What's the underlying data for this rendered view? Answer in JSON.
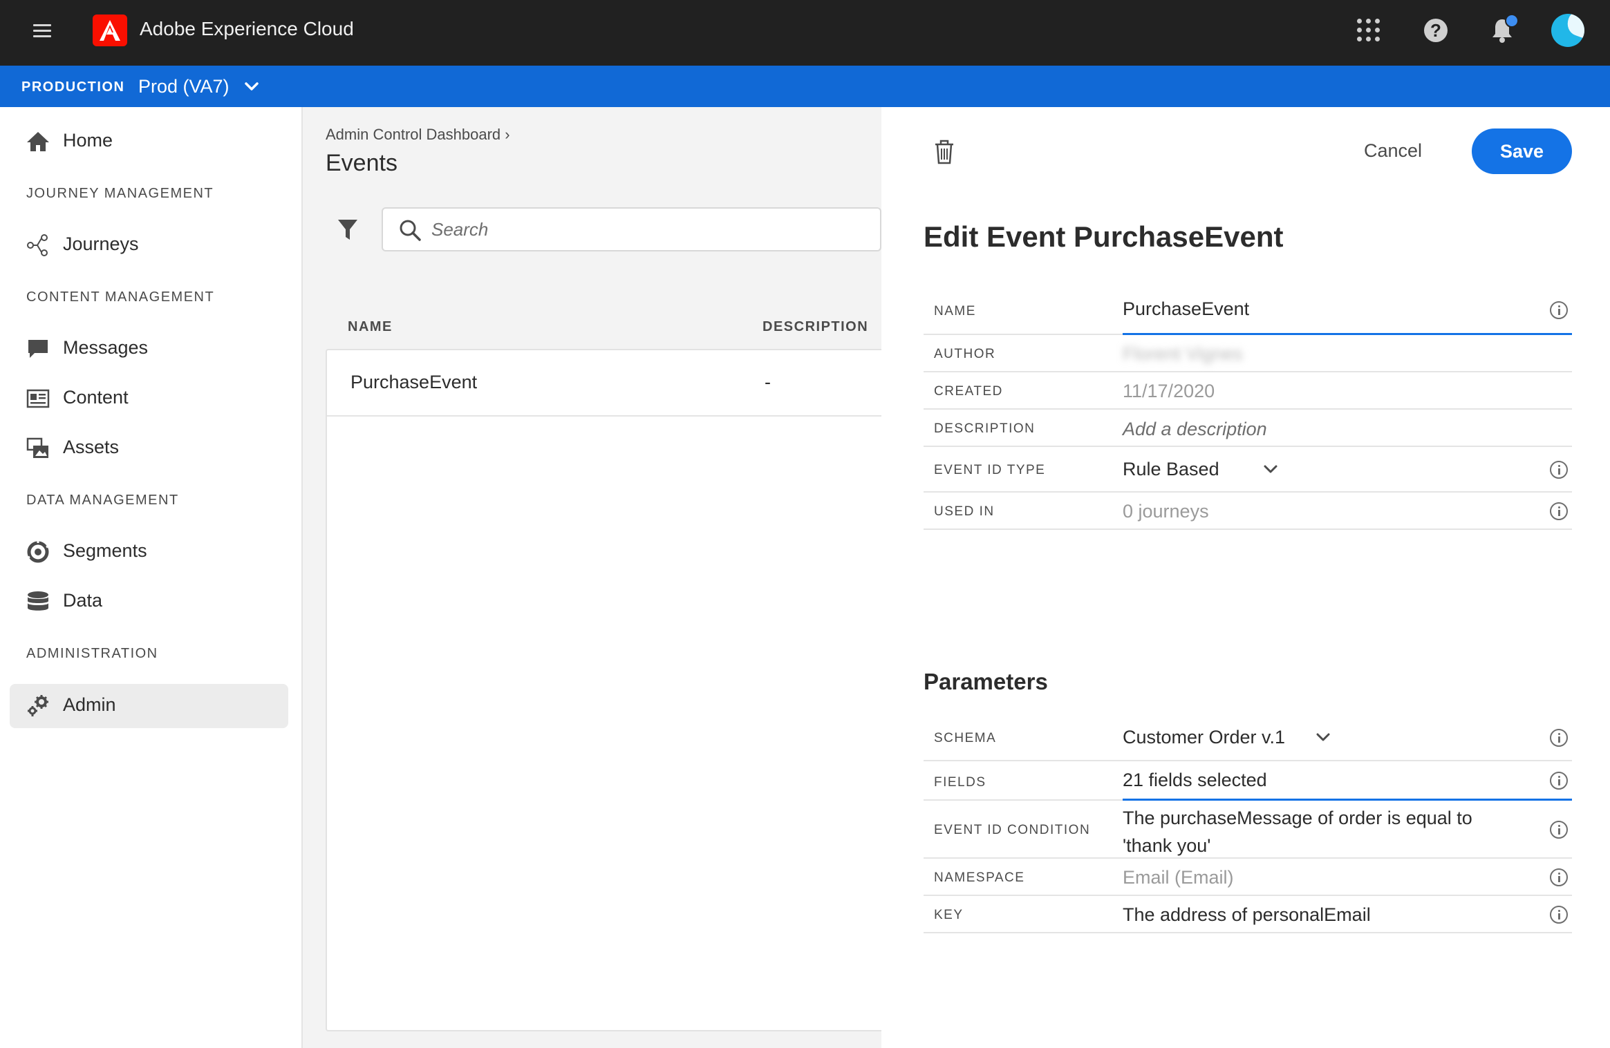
{
  "topbar": {
    "app_title": "Adobe Experience Cloud",
    "icons": [
      "menu-icon",
      "adobe-logo",
      "apps-grid-icon",
      "help-icon",
      "notifications-icon",
      "user-avatar"
    ],
    "notification_dot_color": "#3d8ef2"
  },
  "envbar": {
    "label": "PRODUCTION",
    "value": "Prod (VA7)",
    "background": "#1169d6"
  },
  "sidebar": {
    "home": "Home",
    "sections": {
      "journey": "JOURNEY MANAGEMENT",
      "content": "CONTENT MANAGEMENT",
      "data": "DATA MANAGEMENT",
      "admin": "ADMINISTRATION"
    },
    "items": {
      "journeys": "Journeys",
      "messages": "Messages",
      "content": "Content",
      "assets": "Assets",
      "segments": "Segments",
      "data": "Data",
      "admin": "Admin"
    },
    "active_item": "Admin"
  },
  "events_list": {
    "breadcrumb": "Admin Control Dashboard",
    "title": "Events",
    "search_placeholder": "Search",
    "columns": [
      "NAME",
      "DESCRIPTION"
    ],
    "rows": [
      {
        "name": "PurchaseEvent",
        "description": "-"
      }
    ]
  },
  "edit_panel": {
    "cancel_label": "Cancel",
    "save_label": "Save",
    "title": "Edit Event PurchaseEvent",
    "accent_color": "#1473e6",
    "fields": {
      "name": {
        "label": "NAME",
        "value": "PurchaseEvent"
      },
      "author": {
        "label": "AUTHOR",
        "value": "Florent Vignes"
      },
      "created": {
        "label": "CREATED",
        "value": "11/17/2020"
      },
      "description": {
        "label": "DESCRIPTION",
        "placeholder": "Add a description"
      },
      "event_id_type": {
        "label": "EVENT ID TYPE",
        "value": "Rule Based"
      },
      "used_in": {
        "label": "USED IN",
        "value": "0 journeys"
      }
    },
    "parameters_title": "Parameters",
    "parameters": {
      "schema": {
        "label": "SCHEMA",
        "value": "Customer Order v.1"
      },
      "fields": {
        "label": "FIELDS",
        "value": "21 fields selected"
      },
      "event_id_condition": {
        "label": "EVENT ID CONDITION",
        "line1": "The purchaseMessage of order is equal to",
        "line2": "'thank you'"
      },
      "namespace": {
        "label": "NAMESPACE",
        "value": "Email (Email)"
      },
      "key": {
        "label": "KEY",
        "value": "The address of personalEmail"
      }
    }
  }
}
